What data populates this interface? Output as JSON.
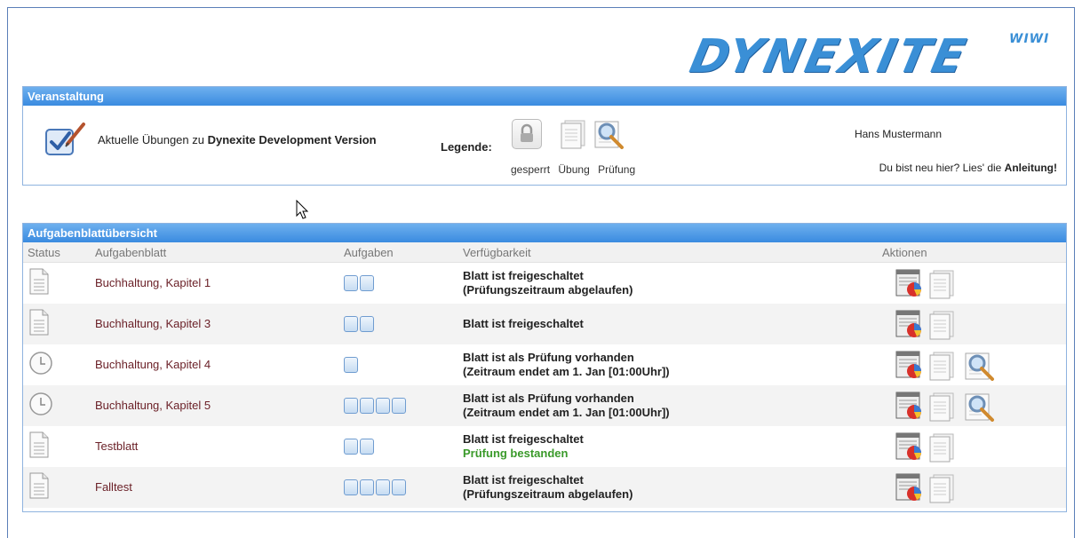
{
  "brand": {
    "logo_text": "DYNEXITE",
    "logo_sup": "WIWI",
    "accent": "#3a8fd6"
  },
  "veranstaltung": {
    "header": "Veranstaltung",
    "intro_prefix": "Aktuelle Übungen zu ",
    "course_name": "Dynexite Development Version",
    "legend_label": "Legende:",
    "legend_items": [
      "gesperrt",
      "Übung",
      "Prüfung"
    ],
    "user_name": "Hans Mustermann",
    "help_prefix": "Du bist neu hier? Lies' die ",
    "help_link": "Anleitung!"
  },
  "overview": {
    "header": "Aufgabenblattübersicht",
    "columns": [
      "Status",
      "Aufgabenblatt",
      "Aufgaben",
      "Verfügbarkeit",
      "Aktionen"
    ],
    "rows": [
      {
        "status": "document",
        "name": "Buchhaltung, Kapitel 1",
        "tasks": 2,
        "line1": "Blatt ist freigeschaltet",
        "line2": "(Prüfungszeitraum abgelaufen)",
        "line2_status": "normal",
        "exam_action": false
      },
      {
        "status": "document",
        "name": "Buchhaltung, Kapitel 3",
        "tasks": 2,
        "line1": "Blatt ist freigeschaltet",
        "line2": "",
        "line2_status": "normal",
        "exam_action": false
      },
      {
        "status": "clock",
        "name": "Buchhaltung, Kapitel 4",
        "tasks": 1,
        "line1": "Blatt ist als Prüfung vorhanden",
        "line2": "(Zeitraum endet am 1. Jan [01:00Uhr])",
        "line2_status": "normal",
        "exam_action": true
      },
      {
        "status": "clock",
        "name": "Buchhaltung, Kapitel 5",
        "tasks": 4,
        "line1": "Blatt ist als Prüfung vorhanden",
        "line2": "(Zeitraum endet am 1. Jan [01:00Uhr])",
        "line2_status": "normal",
        "exam_action": true
      },
      {
        "status": "document",
        "name": "Testblatt",
        "tasks": 2,
        "line1": "Blatt ist freigeschaltet",
        "line2": "Prüfung bestanden",
        "line2_status": "passed",
        "exam_action": false
      },
      {
        "status": "document",
        "name": "Falltest",
        "tasks": 4,
        "line1": "Blatt ist freigeschaltet",
        "line2": "(Prüfungszeitraum abgelaufen)",
        "line2_status": "normal",
        "exam_action": false
      }
    ]
  },
  "colors": {
    "header_blue": "#3a8be0",
    "name_red": "#6b2128",
    "passed_green": "#3a9a2a"
  }
}
